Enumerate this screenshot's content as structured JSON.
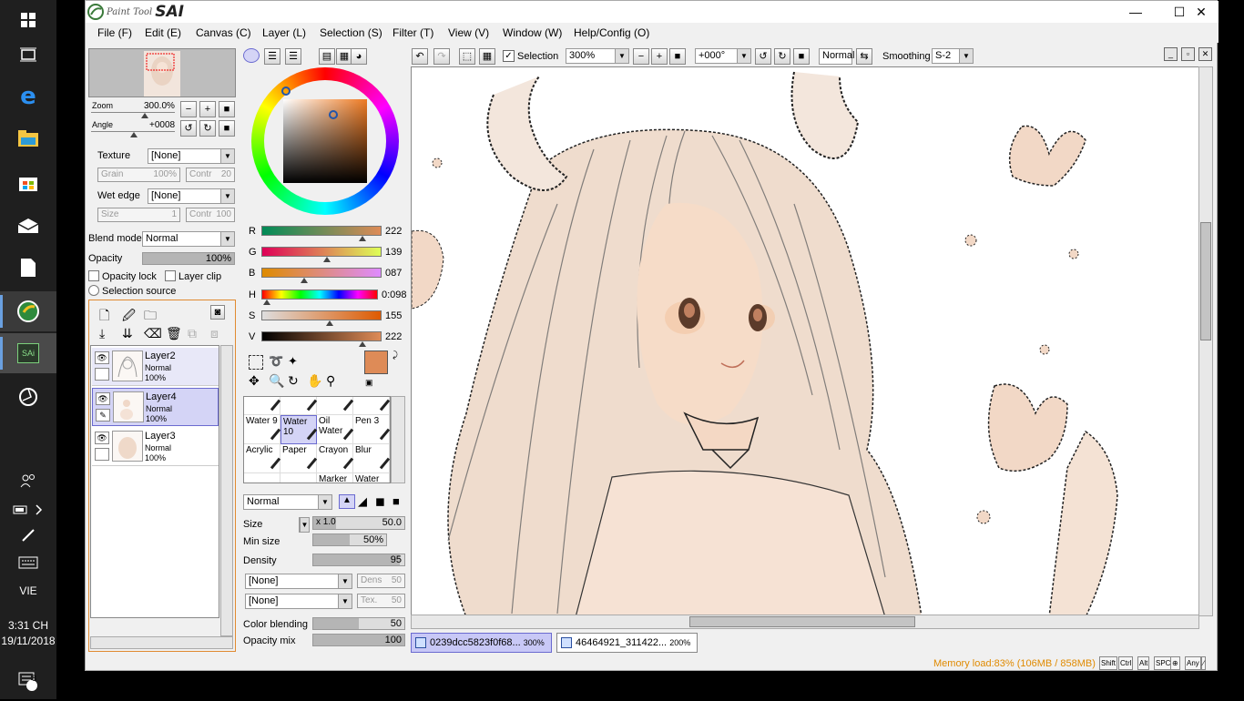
{
  "taskbar": {
    "time": "3:31 CH",
    "date": "19/11/2018",
    "lang": "VIE",
    "notif_count": "8",
    "sai_label": "SAi"
  },
  "app": {
    "logo_small": "Paint Tool",
    "logo_big": "SAI"
  },
  "menu": [
    "File (F)",
    "Edit (E)",
    "Canvas (C)",
    "Layer (L)",
    "Selection (S)",
    "Filter (T)",
    "View (V)",
    "Window (W)",
    "Help/Config (O)"
  ],
  "window_controls": {
    "minimize": "—",
    "maximize": "☐",
    "close": "✕"
  },
  "toolbar": {
    "selection_label": "Selection",
    "zoom": "300%",
    "angle": "+000°",
    "blend": "Normal",
    "smoothing_label": "Smoothing",
    "smoothing": "S-2"
  },
  "navigator": {
    "zoom_label": "Zoom",
    "zoom": "300.0%",
    "angle_label": "Angle",
    "angle": "+0008"
  },
  "texture": {
    "texture_label": "Texture",
    "texture_value": "[None]",
    "grain_label": "Grain",
    "grain": "100%",
    "contr_label": "Contr",
    "contr": "20",
    "wet_edge_label": "Wet edge",
    "wet_value": "[None]",
    "size_label": "Size",
    "size": "1",
    "contr2": "100"
  },
  "layer_props": {
    "blend_label": "Blend mode",
    "blend": "Normal",
    "opacity_label": "Opacity",
    "opacity": "100%",
    "opacity_lock": "Opacity lock",
    "layer_clip": "Layer clip",
    "selection_source": "Selection source"
  },
  "layers": [
    {
      "name": "Layer2",
      "mode": "Normal",
      "opacity": "100%"
    },
    {
      "name": "Layer4",
      "mode": "Normal",
      "opacity": "100%"
    },
    {
      "name": "Layer3",
      "mode": "Normal",
      "opacity": "100%"
    }
  ],
  "color": {
    "r_label": "R",
    "g_label": "G",
    "b_label": "B",
    "h_label": "H",
    "s_label": "S",
    "v_label": "V",
    "r": "222",
    "g": "139",
    "b": "087",
    "h": "0:098",
    "s": "155",
    "v": "222",
    "primary": "#de8b57",
    "secondary": "#888888"
  },
  "brushes": [
    [
      "Bucket",
      "Binary",
      "Ink Pen",
      "Pen 2"
    ],
    [
      "Water 9",
      "Water 10",
      "Oil Water",
      "Pen 3"
    ],
    [
      "Acrylic",
      "Paper",
      "Crayon",
      "Blur"
    ],
    [
      "",
      "",
      "Marker",
      "Water co"
    ]
  ],
  "brush_settings": {
    "mode": "Normal",
    "size_label": "Size",
    "size_mult": "x 1.0",
    "size": "50.0",
    "minsize_label": "Min size",
    "minsize": "50%",
    "density_label": "Density",
    "density": "95",
    "tex1": "[None]",
    "dens_label": "Dens",
    "dens": "50",
    "tex2": "[None]",
    "tex_label": "Tex.",
    "tex": "50",
    "color_blending_label": "Color blending",
    "color_blending": "50",
    "opacity_mix_label": "Opacity mix",
    "opacity_mix": "100"
  },
  "tabs": [
    {
      "name": "0239dcc5823f0f68...",
      "zoom": "300%"
    },
    {
      "name": "46464921_311422...",
      "zoom": "200%"
    }
  ],
  "status": {
    "memory": "Memory load:83% (106MB / 858MB)",
    "keys": [
      "Shift",
      "Ctrl",
      "Alt",
      "SPC",
      "⊕",
      "Any",
      "∕"
    ]
  }
}
